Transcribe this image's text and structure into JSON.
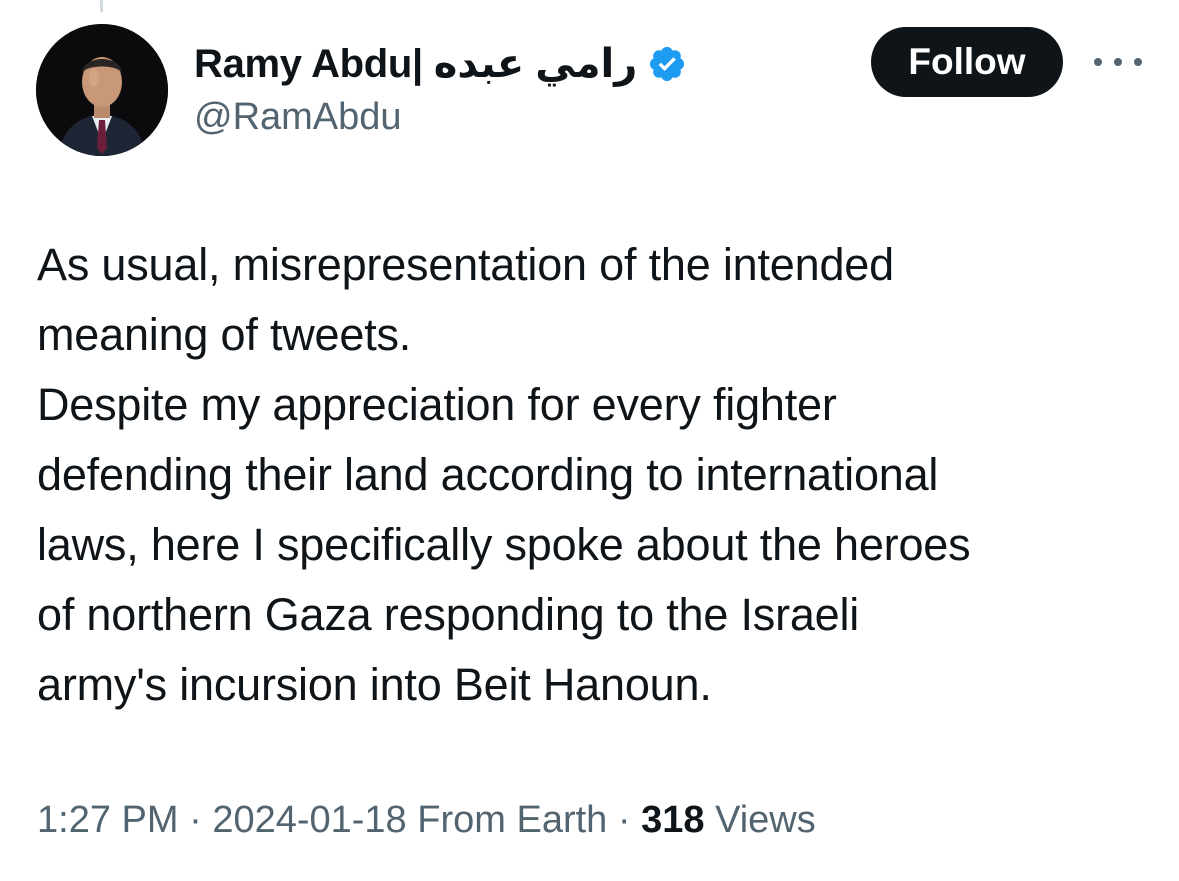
{
  "author": {
    "display_name": "Ramy Abdu| رامي عبده",
    "handle": "@RamAbdu",
    "verified": true,
    "verified_color": "#1d9bf0"
  },
  "actions": {
    "follow_label": "Follow",
    "more_icon": "more-horizontal-icon"
  },
  "tweet": {
    "lines": [
      "As usual, misrepresentation of the intended",
      "meaning of tweets.",
      "Despite my appreciation for every fighter",
      "defending their land according to international",
      "laws, here I specifically spoke about the heroes",
      "of northern Gaza responding to the Israeli",
      "army's incursion into Beit Hanoun."
    ]
  },
  "meta": {
    "time": "1:27 PM",
    "separator": " · ",
    "date": "2024-01-18",
    "location": "From Earth",
    "views_count": "318",
    "views_label": "Views"
  }
}
